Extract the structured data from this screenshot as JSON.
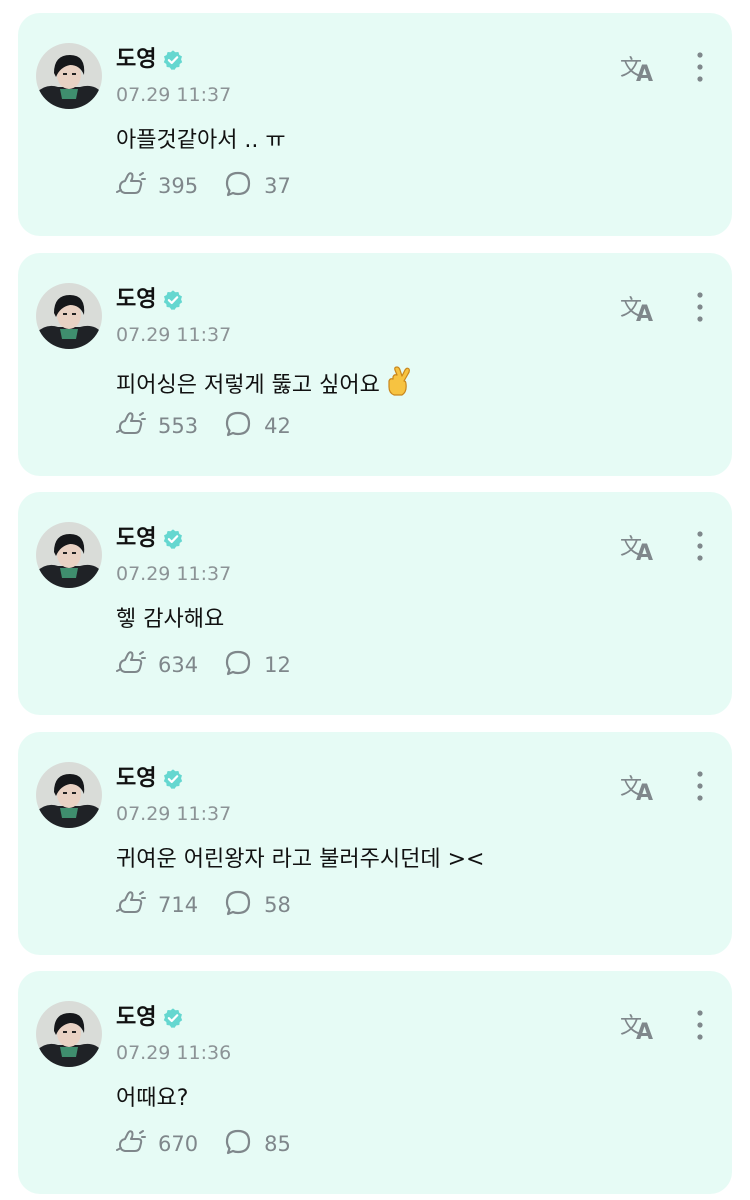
{
  "accent_color": "#65d7d0",
  "card_background": "#e6fbf5",
  "posts": [
    {
      "author": "도영",
      "verified": true,
      "time": "07.29 11:37",
      "text": "아플것같아서 .. ㅠ",
      "likes": "395",
      "comments": "37"
    },
    {
      "author": "도영",
      "verified": true,
      "time": "07.29 11:37",
      "text": "피어싱은 저렇게 뚫고 싶어요",
      "emoji": "crossed-fingers",
      "likes": "553",
      "comments": "42"
    },
    {
      "author": "도영",
      "verified": true,
      "time": "07.29 11:37",
      "text": "헿 감사해요",
      "likes": "634",
      "comments": "12"
    },
    {
      "author": "도영",
      "verified": true,
      "time": "07.29 11:37",
      "text": "귀여운 어린왕자 라고 불러주시던데 ><",
      "likes": "714",
      "comments": "58"
    },
    {
      "author": "도영",
      "verified": true,
      "time": "07.29 11:36",
      "text": "어때요?",
      "likes": "670",
      "comments": "85"
    }
  ]
}
